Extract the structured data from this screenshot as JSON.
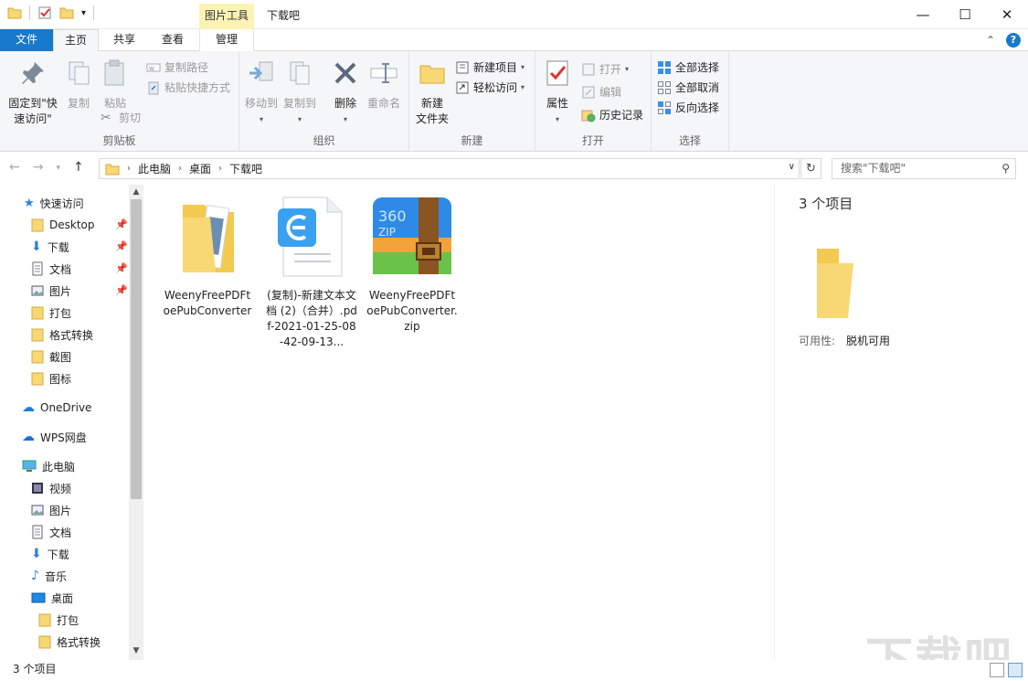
{
  "titlebar": {
    "context_tab": "图片工具",
    "title": "下载吧"
  },
  "tabs": {
    "file": "文件",
    "home": "主页",
    "share": "共享",
    "view": "查看",
    "manage": "管理"
  },
  "ribbon": {
    "clipboard": {
      "label": "剪贴板",
      "pin_line1": "固定到\"快",
      "pin_line2": "速访问\"",
      "copy": "复制",
      "paste": "粘贴",
      "copy_path": "复制路径",
      "paste_shortcut": "粘贴快捷方式",
      "cut": "剪切"
    },
    "organize": {
      "label": "组织",
      "move_to": "移动到",
      "copy_to": "复制到",
      "delete": "删除",
      "rename": "重命名"
    },
    "new": {
      "label": "新建",
      "new_folder_line1": "新建",
      "new_folder_line2": "文件夹",
      "new_item": "新建项目",
      "easy_access": "轻松访问"
    },
    "open": {
      "label": "打开",
      "properties": "属性",
      "open": "打开",
      "edit": "编辑",
      "history": "历史记录"
    },
    "select": {
      "label": "选择",
      "select_all": "全部选择",
      "select_none": "全部取消",
      "invert": "反向选择"
    }
  },
  "address": {
    "crumbs": [
      "此电脑",
      "桌面",
      "下载吧"
    ],
    "search_placeholder": "搜索\"下载吧\""
  },
  "nav": {
    "quick_access": "快速访问",
    "quick_items": [
      "Desktop",
      "下载",
      "文档",
      "图片",
      "打包",
      "格式转换",
      "截图",
      "图标"
    ],
    "onedrive": "OneDrive",
    "wps": "WPS网盘",
    "this_pc": "此电脑",
    "pc_items": [
      "视频",
      "图片",
      "文档",
      "下载",
      "音乐",
      "桌面"
    ],
    "desktop_children": [
      "打包",
      "格式转换"
    ]
  },
  "files": [
    {
      "name": "WeenyFreePDFtoePubConverter",
      "type": "folder"
    },
    {
      "name": "(复制)-新建文本文档 (2)（合并）.pdf-2021-01-25-08-42-09-13...",
      "type": "pdf"
    },
    {
      "name": "WeenyFreePDFtoePubConverter.zip",
      "type": "zip"
    }
  ],
  "details": {
    "count": "3 个项目",
    "availability_label": "可用性:",
    "availability_value": "脱机可用"
  },
  "status": {
    "count": "3 个项目"
  },
  "watermark": "下载吧",
  "colors": {
    "accent": "#1979ca",
    "folder": "#f8d775",
    "context_tab": "#fbf3b3"
  }
}
